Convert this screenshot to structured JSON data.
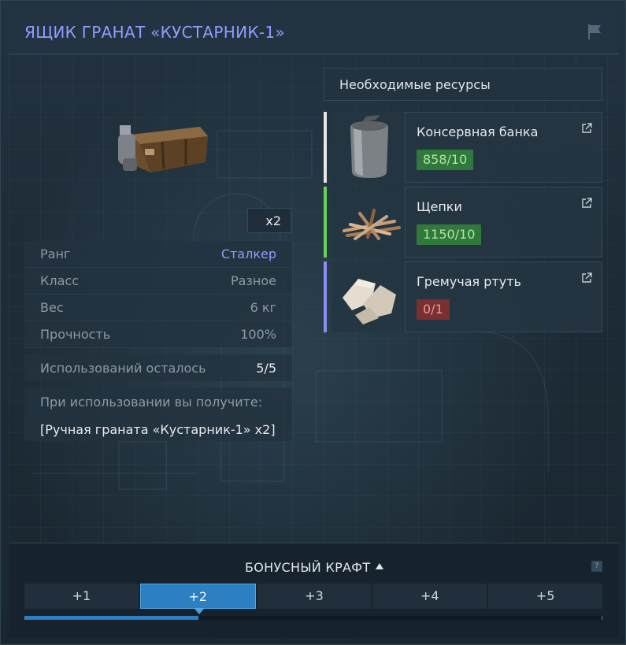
{
  "title": "ЯЩИК ГРАНАТ «КУСТАРНИК-1»",
  "item": {
    "quantity": "x2",
    "stats": [
      {
        "label": "Ранг",
        "value": "Сталкер"
      },
      {
        "label": "Класс",
        "value": "Разное"
      },
      {
        "label": "Вес",
        "value": "6 кг"
      },
      {
        "label": "Прочность",
        "value": "100%"
      }
    ],
    "uses_label": "Использований осталось",
    "uses_value": "5/5",
    "yield_label": "При использовании вы получите:",
    "yield_value": "[Ручная граната «Кустарник-1» x2]"
  },
  "resources": {
    "header": "Необходимые ресурсы",
    "items": [
      {
        "name": "Консервная банка",
        "count": "858/10",
        "status": "ok",
        "tier_color": "#e8e8e8",
        "icon": "tin-can-icon"
      },
      {
        "name": "Щепки",
        "count": "1150/10",
        "status": "ok",
        "tier_color": "#6ad05a",
        "icon": "wood-chips-icon"
      },
      {
        "name": "Гремучая ртуть",
        "count": "0/1",
        "status": "bad",
        "tier_color": "#8c8ff0",
        "icon": "mercury-fulminate-icon"
      }
    ]
  },
  "bonus": {
    "title": "БОНУСНЫЙ КРАФТ",
    "help": "?",
    "tabs": [
      "+1",
      "+2",
      "+3",
      "+4",
      "+5"
    ],
    "active_tab": 1,
    "progress": 0.3
  },
  "colors": {
    "accent": "#8f9dff",
    "active_tab": "#2b7fc2",
    "ok": "#2f7a3a",
    "bad": "#7a2f30"
  }
}
